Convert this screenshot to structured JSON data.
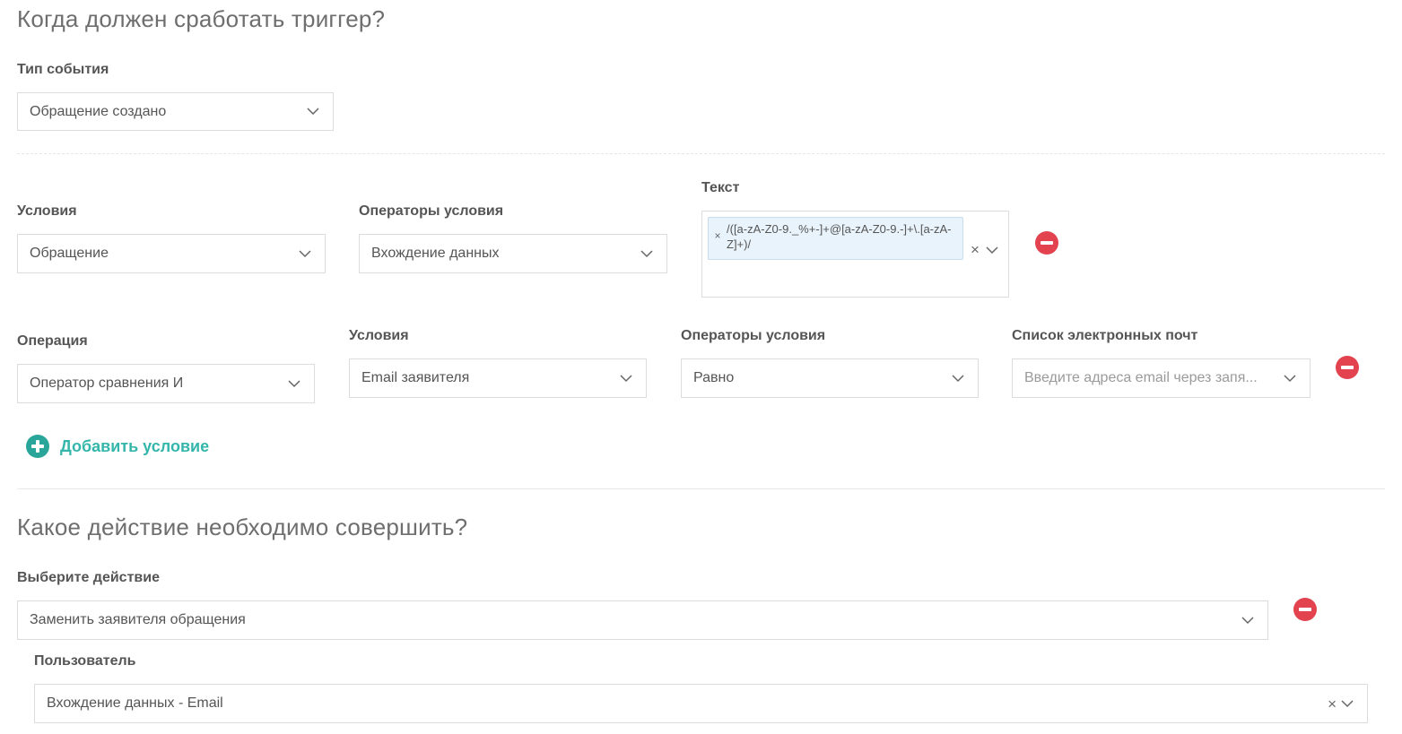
{
  "trigger_section": {
    "title": "Когда должен сработать триггер?",
    "event_type": {
      "label": "Тип события",
      "value": "Обращение создано"
    }
  },
  "condition_row_1": {
    "condition": {
      "label": "Условия",
      "value": "Обращение"
    },
    "operator": {
      "label": "Операторы условия",
      "value": "Вхождение данных"
    },
    "text": {
      "label": "Текст",
      "tag": "/([a-zA-Z0-9._%+-]+@[a-zA-Z0-9.-]+\\.[a-zA-Z]+)/",
      "tag_remove": "×",
      "clear": "×"
    }
  },
  "condition_row_2": {
    "operation": {
      "label": "Операция",
      "value": "Оператор сравнения И"
    },
    "condition": {
      "label": "Условия",
      "value": "Email заявителя"
    },
    "operator": {
      "label": "Операторы условия",
      "value": "Равно"
    },
    "emails": {
      "label": "Список электронных почт",
      "placeholder": "Введите адреса email через запя..."
    }
  },
  "add_condition": {
    "label": "Добавить условие"
  },
  "action_section": {
    "title": "Какое действие необходимо совершить?",
    "action": {
      "label": "Выберите действие",
      "value": "Заменить заявителя обращения"
    },
    "user": {
      "label": "Пользователь",
      "value": "Вхождение данных - Email",
      "clear": "×"
    }
  },
  "icons": {
    "chevron": "chevron-down-icon",
    "remove": "remove-circle-icon",
    "add": "add-circle-icon",
    "clear": "clear-icon"
  },
  "colors": {
    "remove": "#e2434f",
    "add_icon": "#2aa59a",
    "add_text": "#35b6ab",
    "tag_bg": "#e8f3fc"
  }
}
